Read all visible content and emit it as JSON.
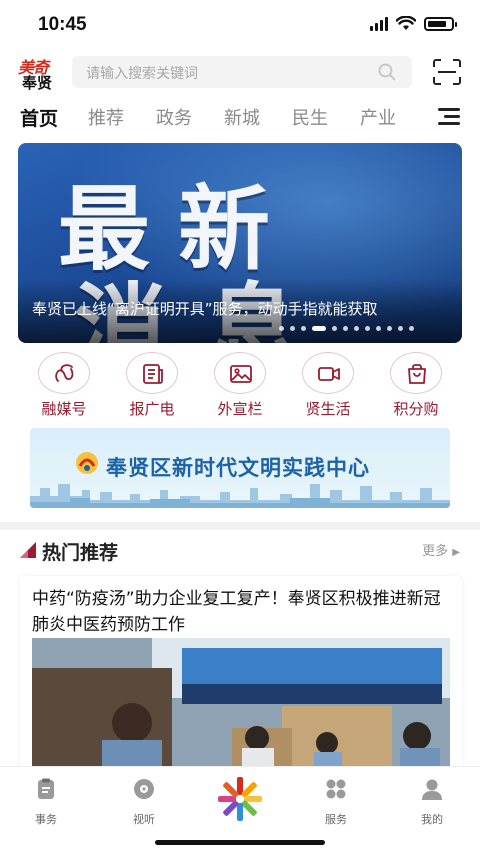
{
  "status_bar": {
    "time": "10:45",
    "icons": [
      "signal-icon",
      "wifi-icon",
      "battery-icon"
    ],
    "battery_level": 0.8
  },
  "header": {
    "logo_top": "美奇",
    "logo_bottom": "奉贤",
    "search_placeholder": "请输入搜索关键词",
    "scan_icon": "scan-icon"
  },
  "tabs": [
    "首页",
    "推荐",
    "政务",
    "新城",
    "民生",
    "产业"
  ],
  "banner": {
    "headline_line1": "最新",
    "headline_line2": "消息",
    "caption": "奉贤已上线“离沪证明开具”服务，动动手指就能获取",
    "dot_count": 12,
    "active_dot": 3
  },
  "shortcuts": [
    {
      "label": "融媒号",
      "icon": "media-icon"
    },
    {
      "label": "报广电",
      "icon": "newspaper-icon"
    },
    {
      "label": "外宣栏",
      "icon": "image-icon"
    },
    {
      "label": "贤生活",
      "icon": "video-icon"
    },
    {
      "label": "积分购",
      "icon": "shopping-bag-icon"
    }
  ],
  "promo": {
    "title": "奉贤区新时代文明实践中心"
  },
  "hot": {
    "title": "热门推荐",
    "more": "更多",
    "article_title": "中药“防疫汤”助力企业复工复产！奉贤区积极推进新冠肺炎中医药预防工作"
  },
  "tabbar": {
    "items": [
      {
        "label": "事务",
        "icon": "clipboard-icon"
      },
      {
        "label": "视听",
        "icon": "disc-icon"
      },
      {
        "label": "服务",
        "icon": "grid-icon"
      },
      {
        "label": "我的",
        "icon": "user-icon"
      }
    ],
    "center_icon": "app-logo-icon"
  },
  "colors": {
    "accent": "#9b1b30",
    "logo_red": "#d8291f",
    "promo_blue": "#1c62a6"
  }
}
